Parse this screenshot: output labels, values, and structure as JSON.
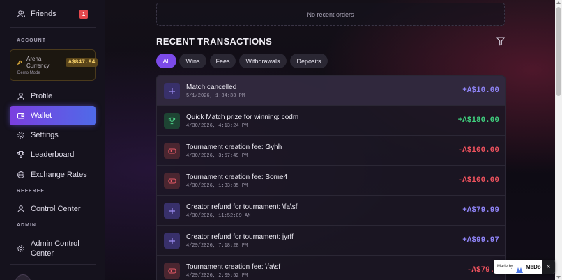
{
  "sidebar": {
    "friends": {
      "label": "Friends",
      "badge": "1"
    },
    "account_section": "ACCOUNT",
    "currency": {
      "name": "Arena Currency",
      "value": "A$847.94",
      "mode": "Demo Mode"
    },
    "items": [
      {
        "label": "Profile"
      },
      {
        "label": "Wallet"
      },
      {
        "label": "Settings"
      },
      {
        "label": "Leaderboard"
      },
      {
        "label": "Exchange Rates"
      }
    ],
    "referee_section": "REFEREE",
    "control_center": "Control Center",
    "admin_section": "ADMIN",
    "admin_control_center": "Admin Control Center"
  },
  "main": {
    "no_orders": "No recent orders",
    "title": "RECENT TRANSACTIONS",
    "filters": [
      "All",
      "Wins",
      "Fees",
      "Withdrawals",
      "Deposits"
    ],
    "transactions": [
      {
        "title": "Match cancelled",
        "date": "5/1/2026, 1:34:33 PM",
        "amount": "+A$10.00",
        "kind": "refund"
      },
      {
        "title": "Quick Match prize for winning: codm",
        "date": "4/30/2026, 4:13:24 PM",
        "amount": "+A$180.00",
        "kind": "win"
      },
      {
        "title": "Tournament creation fee: Gyhh",
        "date": "4/30/2026, 3:57:49 PM",
        "amount": "-A$100.00",
        "kind": "fee"
      },
      {
        "title": "Tournament creation fee: Some4",
        "date": "4/30/2026, 1:33:35 PM",
        "amount": "-A$100.00",
        "kind": "fee"
      },
      {
        "title": "Creator refund for tournament: \\fa\\sf",
        "date": "4/30/2026, 11:52:09 AM",
        "amount": "+A$79.99",
        "kind": "refund"
      },
      {
        "title": "Creator refund for tournament: jyrff",
        "date": "4/29/2026, 7:18:28 PM",
        "amount": "+A$99.97",
        "kind": "refund"
      },
      {
        "title": "Tournament creation fee: \\fa\\sf",
        "date": "4/29/2026, 2:09:52 PM",
        "amount": "-A$79.9",
        "kind": "fee"
      }
    ]
  },
  "badge": {
    "made_by": "Made by",
    "brand": "MeDo",
    "close": "×"
  },
  "colors": {
    "accent": "#7b4ae8",
    "positive": "#3fd17f",
    "negative": "#f0525e",
    "refund": "#8f84f7"
  }
}
